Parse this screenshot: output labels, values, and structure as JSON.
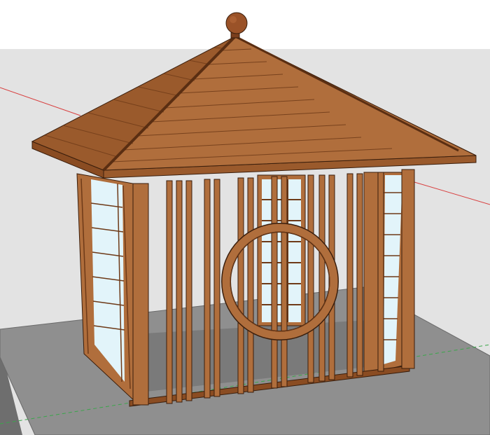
{
  "viewport": {
    "sky_color": "#ffffff",
    "ground_color": "#e3e3e3",
    "floor_color": "#8f8f8f"
  },
  "axes": {
    "red_axis_color": "#d84040",
    "green_axis_color": "#3aa64a"
  },
  "model": {
    "wood_light": "#b06e3c",
    "wood_mid": "#9a5a2c",
    "wood_dark": "#6e3a18",
    "outline": "#3a1e0c",
    "glass": "#e2f4fa",
    "glass_shade": "#b8dcea",
    "finial_color": "#9a5228",
    "icons": [
      "gazebo-model",
      "roof",
      "finial",
      "moon-gate"
    ]
  }
}
